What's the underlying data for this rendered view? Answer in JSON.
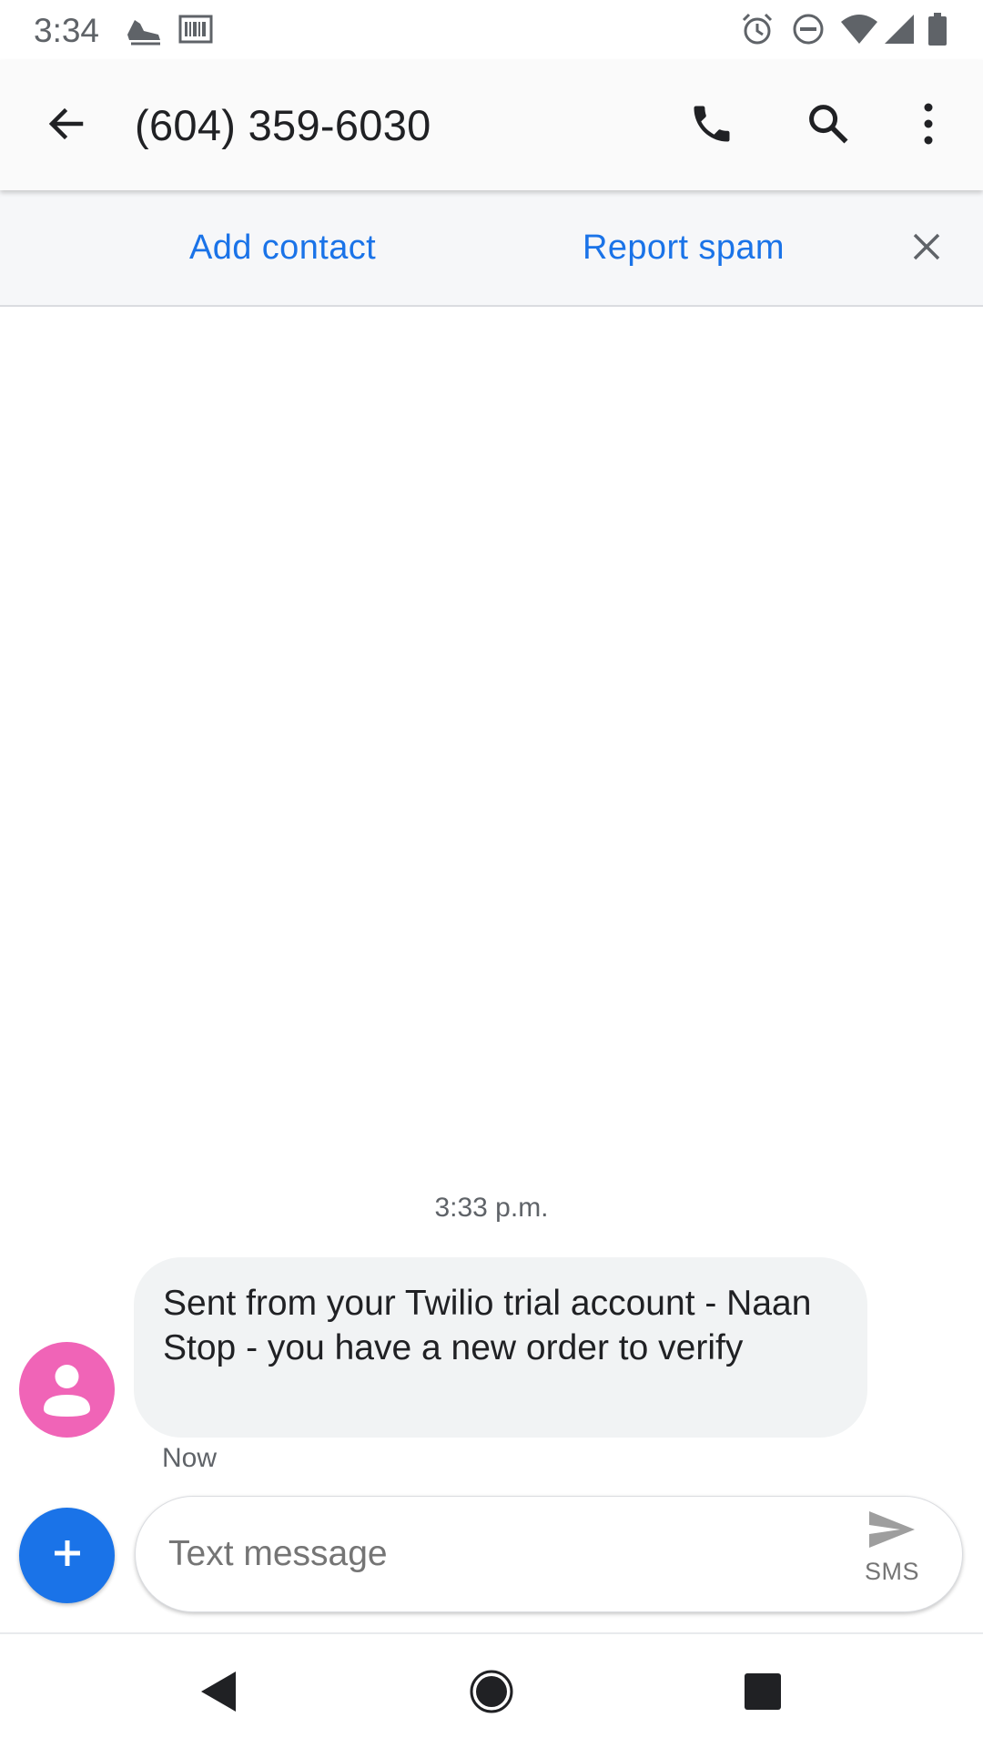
{
  "status_bar": {
    "time": "3:34",
    "left_icons": [
      "shoe-icon",
      "barcode-icon"
    ],
    "right_icons": [
      "alarm-icon",
      "do-not-disturb-icon",
      "wifi-icon",
      "cell-signal-icon",
      "battery-icon"
    ]
  },
  "app_bar": {
    "title": "(604) 359-6030",
    "icons": [
      "back-arrow-icon",
      "phone-icon",
      "search-icon",
      "more-vert-icon"
    ]
  },
  "banner": {
    "add_contact": "Add contact",
    "report_spam": "Report spam",
    "close_icon": "close-icon"
  },
  "conversation": {
    "timestamp": "3:33 p.m.",
    "messages": [
      {
        "text": "Sent from your Twilio trial account - Naan Stop - you have a new order to verify",
        "meta": "Now",
        "avatar_color": "#f064b7"
      }
    ]
  },
  "compose": {
    "placeholder": "Text message",
    "value": "",
    "send_label": "SMS",
    "add_icon": "plus-icon"
  },
  "nav_bar": {
    "icons": [
      "nav-back-icon",
      "nav-home-icon",
      "nav-recents-icon"
    ]
  },
  "colors": {
    "accent": "#1a73e8",
    "avatar": "#f064b7",
    "bubble": "#f1f3f4"
  }
}
